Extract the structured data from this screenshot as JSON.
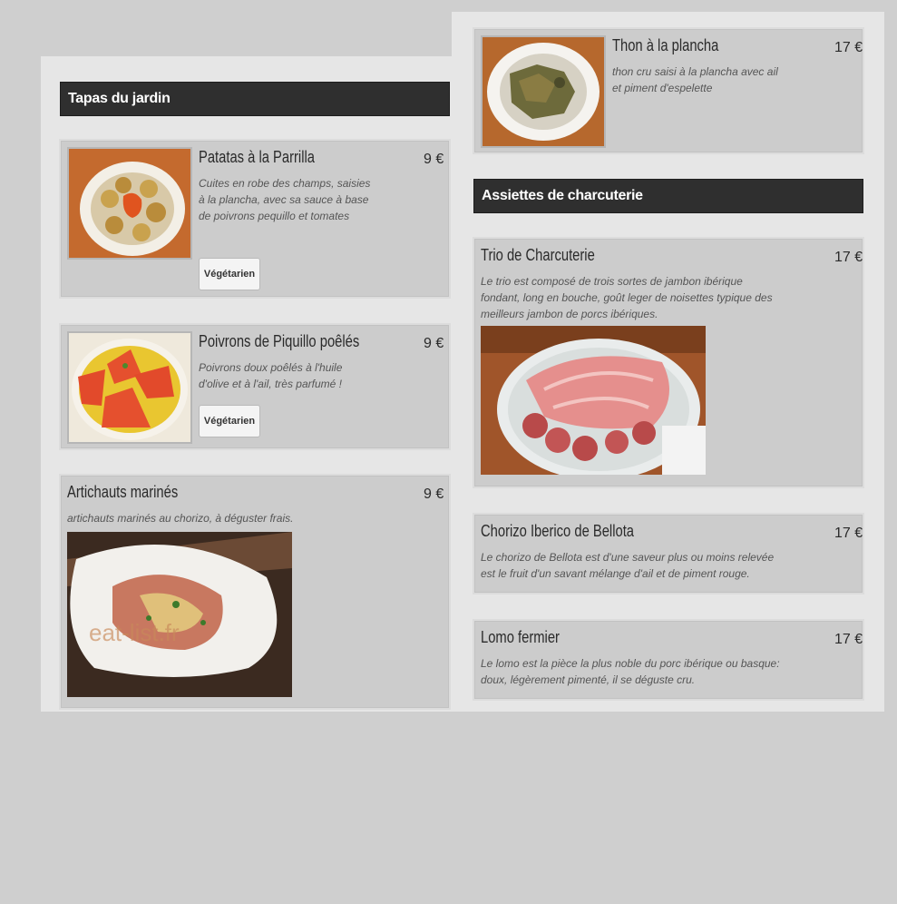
{
  "sections": {
    "tapas": {
      "title": "Tapas du jardin"
    },
    "charcuterie": {
      "title": "Assiettes de charcuterie"
    }
  },
  "items": {
    "patatas": {
      "name": "Patatas à la Parrilla",
      "price": "9 €",
      "description": "Cuites en robe des champs, saisies à la plancha, avec sa sauce à base de poivrons pequillo et tomates",
      "tag": "Végétarien"
    },
    "poivrons": {
      "name": "Poivrons de Piquillo poêlés",
      "price": "9 €",
      "description": "Poivrons doux poêlés à l'huile d'olive et à l'ail, très parfumé !",
      "tag": "Végétarien"
    },
    "artichauts": {
      "name": "Artichauts marinés",
      "price": "9 €",
      "description": "artichauts marinés au chorizo, à déguster frais.",
      "watermark": "eat-list.fr"
    },
    "thon": {
      "name": "Thon à la plancha",
      "price": "17 €",
      "description": "thon cru saisi à la plancha avec ail et piment d'espelette"
    },
    "trio": {
      "name": "Trio de Charcuterie",
      "price": "17 €",
      "description": "Le trio est composé de trois sortes de jambon ibérique fondant, long en bouche, goût leger de noisettes typique des meilleurs jambon de porcs ibériques."
    },
    "chorizo": {
      "name": "Chorizo Iberico de Bellota",
      "price": "17 €",
      "description": "Le chorizo de Bellota est d'une saveur plus ou moins relevée est le fruit d'un savant mélange d'ail et de piment rouge."
    },
    "lomo": {
      "name": "Lomo fermier",
      "price": "17 €",
      "description": "Le lomo est la pièce la plus noble du porc ibérique ou basque:  doux, légèrement pimenté, il se déguste cru."
    }
  }
}
